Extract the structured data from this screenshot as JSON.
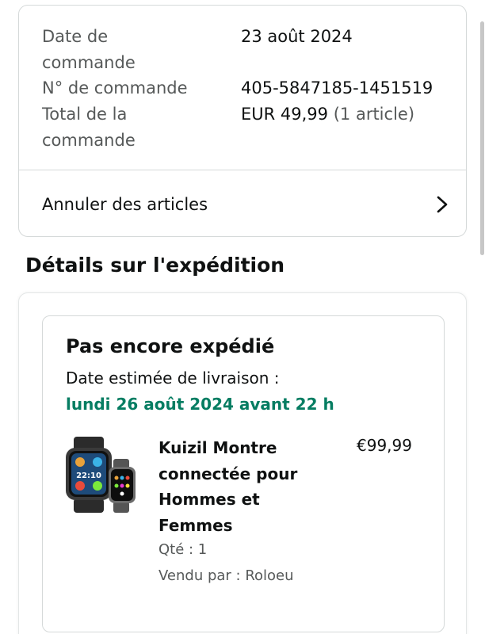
{
  "order_info": {
    "date_label": "Date de commande",
    "date_value": "23 août 2024",
    "number_label": "N° de commande",
    "number_value": "405-5847185-1451519",
    "total_label": "Total de la commande",
    "total_value": "EUR 49,99",
    "total_count": "(1 article)"
  },
  "cancel_items_label": "Annuler des articles",
  "shipment_section_title": "Détails sur l'expédition",
  "shipment": {
    "status": "Pas encore expédié",
    "delivery_label": "Date estimée de livraison :",
    "delivery_date": "lundi 26 août 2024 avant 22 h",
    "delivery_date_color": "#067d62"
  },
  "product": {
    "title": "Kuizil Montre connectée pour Hommes et Femmes",
    "price": "€99,99",
    "quantity": "Qté : 1",
    "seller": "Vendu par : Roloeu",
    "watch_time": "22:10"
  },
  "icons": {
    "cancel_chevron": "chevron-right-icon"
  }
}
